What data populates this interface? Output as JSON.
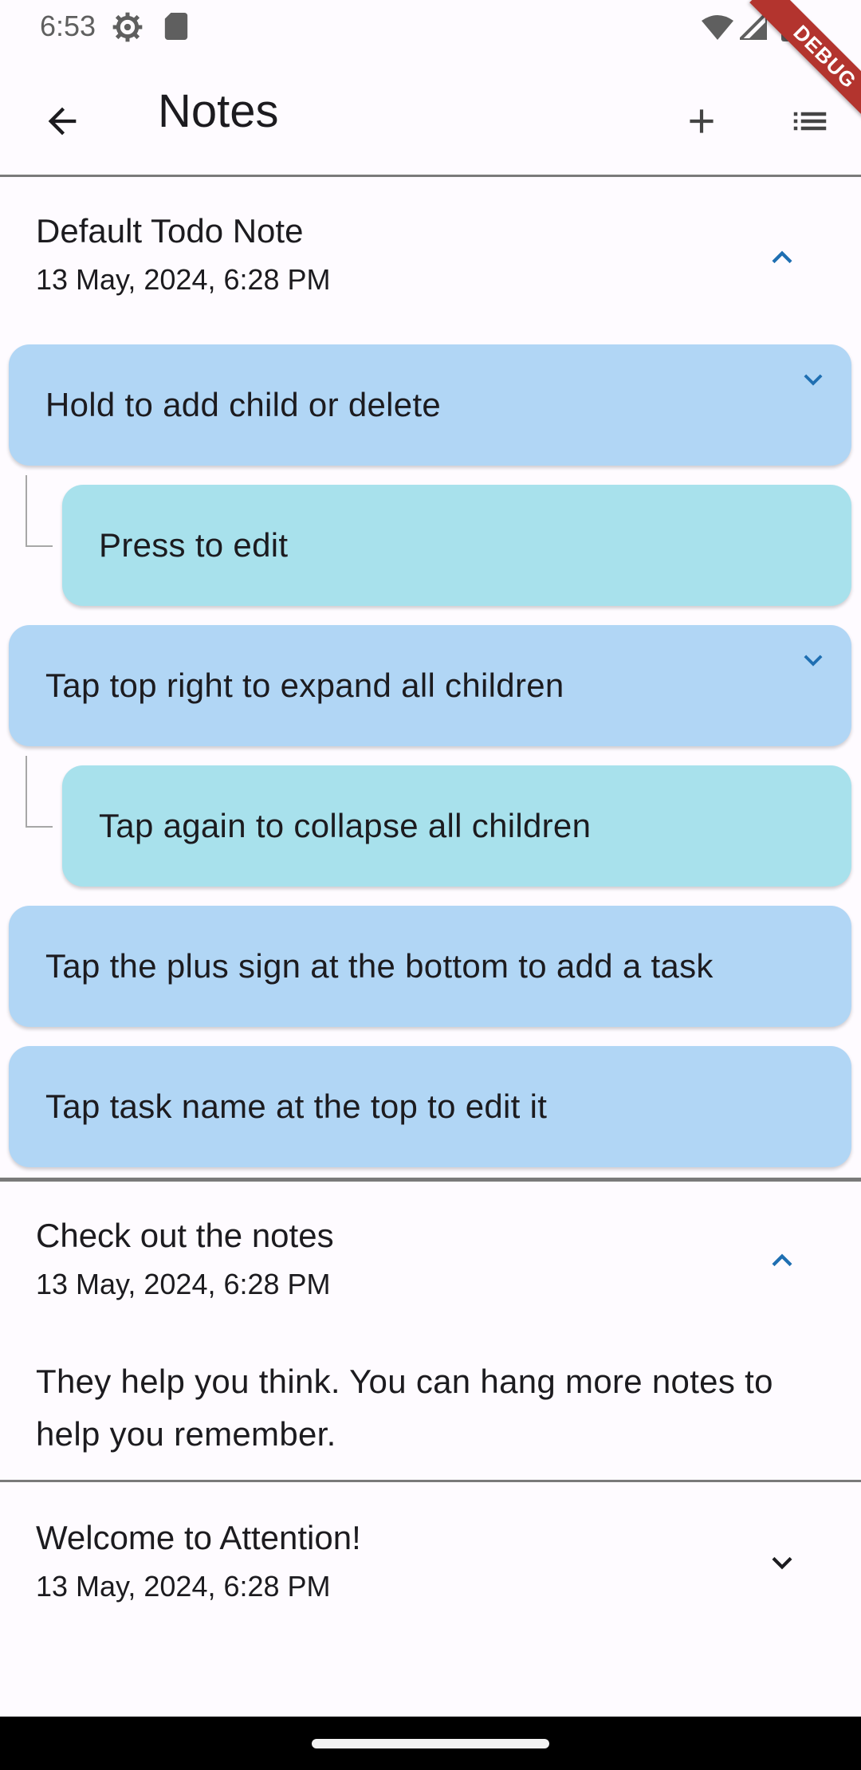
{
  "status_bar": {
    "time": "6:53"
  },
  "debug_banner": {
    "label": "DEBUG"
  },
  "app_bar": {
    "title": "Notes"
  },
  "notes": [
    {
      "title": "Default Todo Note",
      "date": "13 May, 2024, 6:28 PM",
      "expanded": true,
      "tasks": [
        {
          "label": "Hold to add child or delete",
          "level": 0
        },
        {
          "label": "Press to edit",
          "level": 1
        },
        {
          "label": "Tap top right to expand all children",
          "level": 0
        },
        {
          "label": "Tap again to collapse all children",
          "level": 1
        },
        {
          "label": "Tap the plus sign at the bottom to add a task",
          "level": 0
        },
        {
          "label": "Tap task name at the top to edit it",
          "level": 0
        }
      ]
    },
    {
      "title": "Check out the notes",
      "date": "13 May, 2024, 6:28 PM",
      "expanded": true,
      "body": "They help you think. You can hang more notes to help you remember."
    },
    {
      "title": "Welcome to Attention!",
      "date": "13 May, 2024, 6:28 PM",
      "expanded": false
    }
  ],
  "colors": {
    "accent": "#1f6fb2",
    "parent_task": "#b1d6f5",
    "child_task": "#a8e1ec",
    "background": "#fefbff",
    "debug_ribbon": "#b3342e"
  }
}
